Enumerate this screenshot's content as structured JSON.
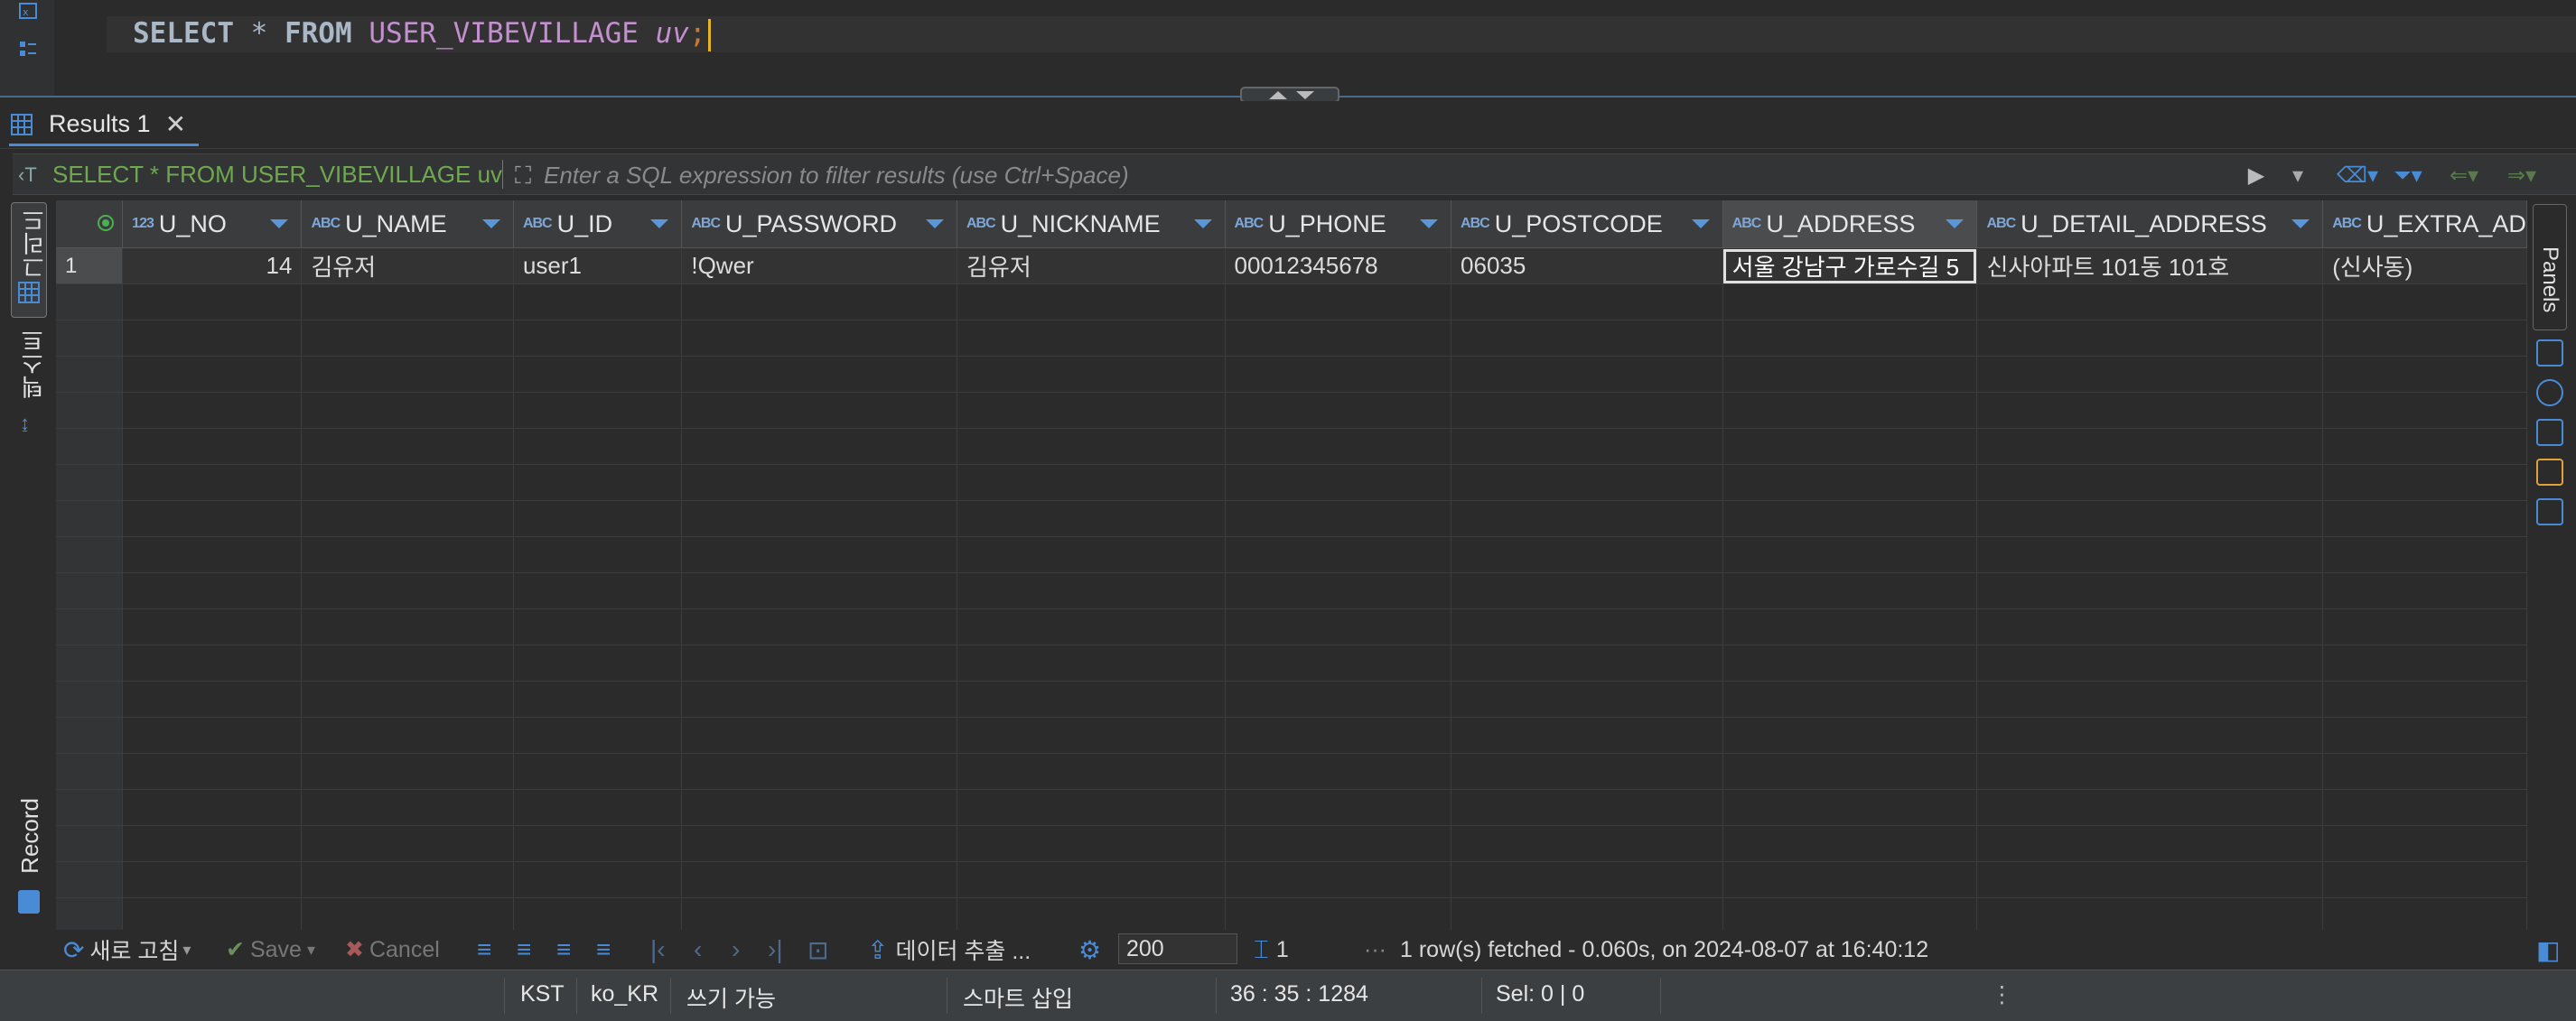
{
  "editor": {
    "sql_select": "SELECT",
    "sql_star": " * ",
    "sql_from": "FROM",
    "sql_table": "USER_VIBEVILLAGE",
    "sql_alias": "uv",
    "sql_semicolon": ";"
  },
  "results_tab": {
    "label": "Results 1",
    "close": "✕"
  },
  "filter": {
    "query": "SELECT * FROM USER_VIBEVILLAGE uv",
    "placeholder": "Enter a SQL expression to filter results (use Ctrl+Space)"
  },
  "side_tabs": {
    "grid": "그리드",
    "text": "텍스트",
    "record": "Record",
    "panels": "Panels"
  },
  "columns": [
    {
      "type": "123",
      "name": "U_NO"
    },
    {
      "type": "ABC",
      "name": "U_NAME"
    },
    {
      "type": "ABC",
      "name": "U_ID"
    },
    {
      "type": "ABC",
      "name": "U_PASSWORD"
    },
    {
      "type": "ABC",
      "name": "U_NICKNAME"
    },
    {
      "type": "ABC",
      "name": "U_PHONE"
    },
    {
      "type": "ABC",
      "name": "U_POSTCODE"
    },
    {
      "type": "ABC",
      "name": "U_ADDRESS"
    },
    {
      "type": "ABC",
      "name": "U_DETAIL_ADDRESS"
    },
    {
      "type": "ABC",
      "name": "U_EXTRA_AD"
    }
  ],
  "rows": [
    {
      "num": "1",
      "cells": [
        "14",
        "김유저",
        "user1",
        "!Qwer",
        "김유저",
        "00012345678",
        "06035",
        "서울 강남구 가로수길 5",
        "신사아파트 101동 101호",
        "(신사동)"
      ]
    }
  ],
  "toolbar": {
    "refresh": "새로 고침",
    "save": "Save",
    "cancel": "Cancel",
    "export": "데이터 추출 ...",
    "fetch_size": "200",
    "row_count": "1",
    "status": "1 row(s) fetched - 0.060s, on 2024-08-07 at 16:40:12"
  },
  "statusbar": {
    "timezone": "KST",
    "locale": "ko_KR",
    "write_mode": "쓰기 가능",
    "insert_mode": "스마트 삽입",
    "cursor": "36 : 35 : 1284",
    "selection": "Sel: 0 | 0"
  },
  "colors": {
    "accent": "#4a8bd6",
    "sql_green": "#6fa84e",
    "keyword": "#a9b7c6",
    "table_name": "#c48fcf"
  }
}
